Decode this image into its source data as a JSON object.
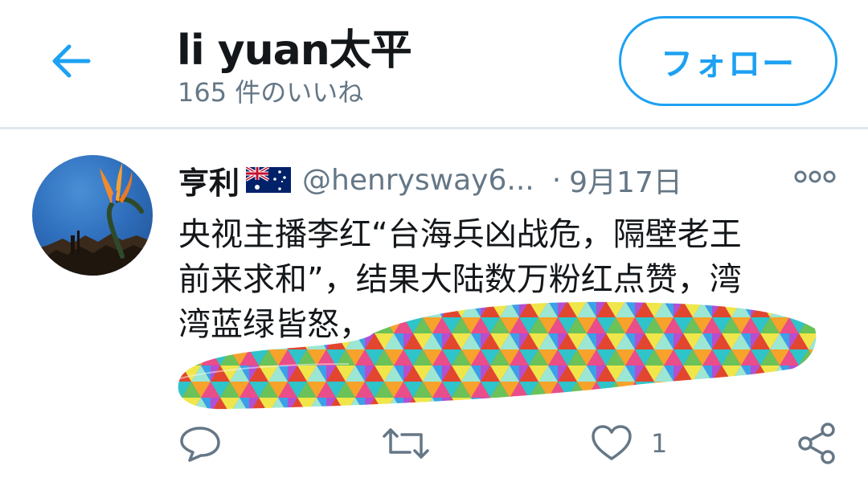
{
  "header": {
    "title": "li yuan太平",
    "subtitle": "165 件のいいね",
    "back_icon": "arrow-left-icon",
    "follow_label": "フォロー"
  },
  "tweet": {
    "author_name": "亨利",
    "flag_icon": "australia-flag-icon",
    "handle": "@henrysway6...",
    "separator": "·",
    "date": "9月17日",
    "more_icon": "more-dots-icon",
    "text": "央视主播李红“台海兵凶战危，隔壁老王\n前来求和”，结果大陆数万粉红点赞，湾\n湾蓝绿皆怒，\n",
    "actions": {
      "reply_icon": "reply-bubble-icon",
      "retweet_icon": "retweet-icon",
      "like_icon": "heart-icon",
      "like_count": "1",
      "share_icon": "share-icon"
    }
  },
  "colors": {
    "accent": "#1da1f2",
    "text_primary": "#14171a",
    "text_secondary": "#657786",
    "divider": "#e1e8ed"
  }
}
